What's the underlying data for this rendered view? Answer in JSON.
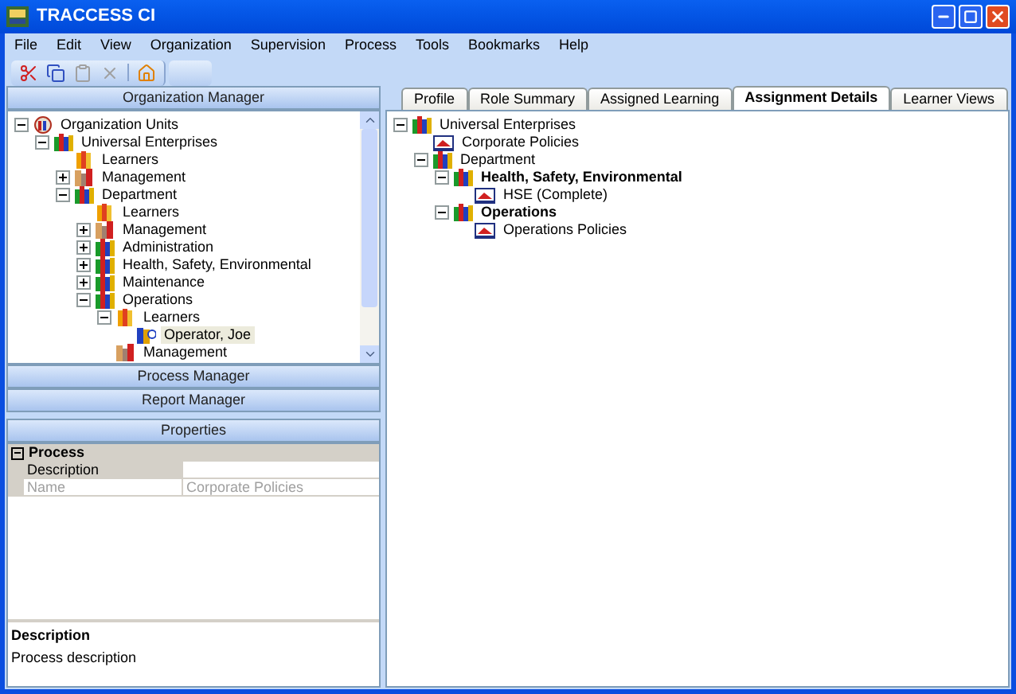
{
  "window": {
    "title": "TRACCESS CI"
  },
  "menu": [
    "File",
    "Edit",
    "View",
    "Organization",
    "Supervision",
    "Process",
    "Tools",
    "Bookmarks",
    "Help"
  ],
  "toolbar": [
    {
      "kind": "cut",
      "disabled": false
    },
    {
      "kind": "copy",
      "disabled": false
    },
    {
      "kind": "paste",
      "disabled": true
    },
    {
      "kind": "delete",
      "disabled": true
    },
    {
      "kind": "home",
      "disabled": false
    }
  ],
  "organization_manager": {
    "title": "Organization Manager",
    "tree": [
      {
        "label": "Organization Units",
        "kind": "org",
        "expanded": true,
        "selected": false,
        "children": [
          {
            "label": "Universal Enterprises",
            "kind": "group",
            "expanded": true,
            "selected": false,
            "children": [
              {
                "label": "Learners",
                "kind": "learners",
                "selected": false
              },
              {
                "label": "Management",
                "kind": "management",
                "expanded": false,
                "selected": false
              },
              {
                "label": "Department",
                "kind": "group",
                "expanded": true,
                "selected": false,
                "children": [
                  {
                    "label": "Learners",
                    "kind": "learners",
                    "selected": false
                  },
                  {
                    "label": "Management",
                    "kind": "management",
                    "expanded": false,
                    "selected": false
                  },
                  {
                    "label": "Administration",
                    "kind": "group",
                    "expanded": false,
                    "selected": false
                  },
                  {
                    "label": "Health, Safety, Environmental",
                    "kind": "group",
                    "expanded": false,
                    "selected": false
                  },
                  {
                    "label": "Maintenance",
                    "kind": "group",
                    "expanded": false,
                    "selected": false
                  },
                  {
                    "label": "Operations",
                    "kind": "group",
                    "expanded": true,
                    "selected": false,
                    "children": [
                      {
                        "label": "Learners",
                        "kind": "learners",
                        "expanded": true,
                        "selected": false,
                        "children": [
                          {
                            "label": "Operator, Joe",
                            "kind": "person",
                            "selected": true
                          }
                        ]
                      },
                      {
                        "label": "Management",
                        "kind": "management",
                        "selected": false
                      }
                    ]
                  }
                ]
              }
            ]
          }
        ]
      }
    ]
  },
  "sections": [
    "Process Manager",
    "Report Manager"
  ],
  "properties": {
    "title": "Properties",
    "category": {
      "label": "Process",
      "expanded": true
    },
    "rows": [
      {
        "name": "Description",
        "selected": true,
        "disabled": false
      },
      {
        "name": "Name",
        "value": "Corporate Policies",
        "selected": false,
        "disabled": true
      }
    ],
    "help": {
      "title": "Description",
      "text": "Process description"
    }
  },
  "tabs": [
    {
      "label": "Profile",
      "selected": false
    },
    {
      "label": "Role Summary",
      "selected": false
    },
    {
      "label": "Assigned Learning",
      "selected": false
    },
    {
      "label": "Assignment Details",
      "selected": true
    },
    {
      "label": "Learner Views",
      "selected": false
    }
  ],
  "assignment_tree": [
    {
      "label": "Universal Enterprises",
      "kind": "group",
      "bold": false,
      "expanded": true,
      "children": [
        {
          "label": "Corporate Policies",
          "kind": "policy",
          "bold": false
        },
        {
          "label": "Department",
          "kind": "group",
          "bold": false,
          "expanded": true,
          "children": [
            {
              "label": "Health, Safety, Environmental",
              "kind": "group",
              "bold": true,
              "expanded": true,
              "children": [
                {
                  "label": "HSE (Complete)",
                  "kind": "policy",
                  "bold": false
                }
              ]
            },
            {
              "label": "Operations",
              "kind": "group",
              "bold": true,
              "expanded": true,
              "children": [
                {
                  "label": "Operations Policies",
                  "kind": "policy",
                  "bold": false
                }
              ]
            }
          ]
        }
      ]
    }
  ]
}
